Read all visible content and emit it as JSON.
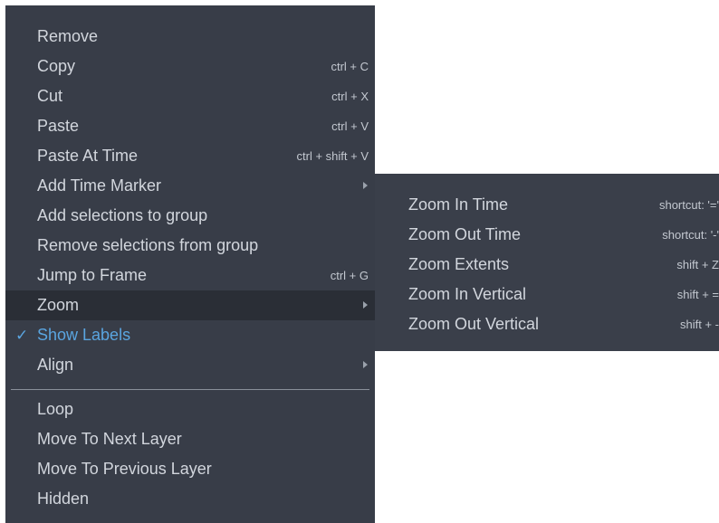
{
  "main_menu": {
    "items": [
      {
        "label": "Remove",
        "shortcut": ""
      },
      {
        "label": "Copy",
        "shortcut": "ctrl + C"
      },
      {
        "label": "Cut",
        "shortcut": "ctrl + X"
      },
      {
        "label": "Paste",
        "shortcut": "ctrl + V"
      },
      {
        "label": "Paste At Time",
        "shortcut": "ctrl + shift + V"
      },
      {
        "label": "Add Time Marker",
        "submenu": true
      },
      {
        "label": "Add selections to group",
        "shortcut": ""
      },
      {
        "label": "Remove selections from group",
        "shortcut": ""
      },
      {
        "label": "Jump to Frame",
        "shortcut": "ctrl + G"
      },
      {
        "label": "Zoom",
        "submenu": true,
        "active": true
      },
      {
        "label": "Show Labels",
        "checked": true,
        "check_glyph": "✓"
      },
      {
        "label": "Align",
        "submenu": true
      },
      {
        "label": "Loop",
        "shortcut": ""
      },
      {
        "label": "Move To Next Layer",
        "shortcut": ""
      },
      {
        "label": "Move To Previous Layer",
        "shortcut": ""
      },
      {
        "label": "Hidden",
        "shortcut": ""
      }
    ]
  },
  "zoom_submenu": {
    "items": [
      {
        "label": "Zoom In Time",
        "shortcut": "shortcut: '='"
      },
      {
        "label": "Zoom Out Time",
        "shortcut": "shortcut: '-'"
      },
      {
        "label": "Zoom Extents",
        "shortcut": "shift + Z"
      },
      {
        "label": "Zoom In Vertical",
        "shortcut": "shift + ="
      },
      {
        "label": "Zoom Out Vertical",
        "shortcut": "shift + -"
      }
    ]
  },
  "colors": {
    "menu_background": "#383d48",
    "active_background": "#2a2e36",
    "text": "#d2d6dd",
    "checked_accent": "#5aa5e0"
  },
  "icons": {
    "check": "check-icon",
    "submenu_arrow": "chevron-right-icon"
  }
}
